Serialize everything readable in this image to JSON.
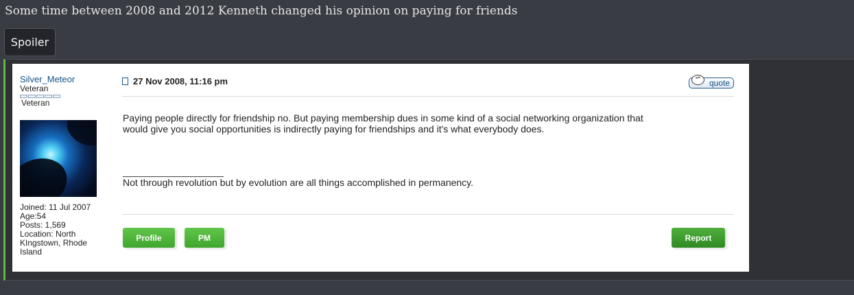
{
  "post": {
    "title": "Some time between 2008 and 2012 Kenneth changed his opinion on paying for friends"
  },
  "spoiler": {
    "label": "Spoiler"
  },
  "quoted_post": {
    "author": {
      "name": "Silver_Meteor",
      "rank": "Veteran",
      "rank_image_label": "Veteran",
      "joined": "Joined: 11 Jul 2007",
      "age": "Age:54",
      "posts": "Posts: 1,569",
      "location": "Location: North KIngstown, Rhode Island"
    },
    "date": "27 Nov 2008, 11:16 pm",
    "quote_label": "quote",
    "body": "Paying people directly for friendship no. But paying membership dues in some kind of a social networking organization that would give you social opportunities is indirectly paying for friendships and it's what everybody does.",
    "signature": "Not through revolution but by evolution are all things accomplished in permanency.",
    "buttons": {
      "profile": "Profile",
      "pm": "PM",
      "report": "Report"
    }
  },
  "colors": {
    "page_bg": "#393c43",
    "spoiler_border": "#63b93c",
    "button_green": "#4fb03c",
    "link_blue": "#105289"
  },
  "icons": [
    "document-icon",
    "quote-bubble-icon"
  ]
}
